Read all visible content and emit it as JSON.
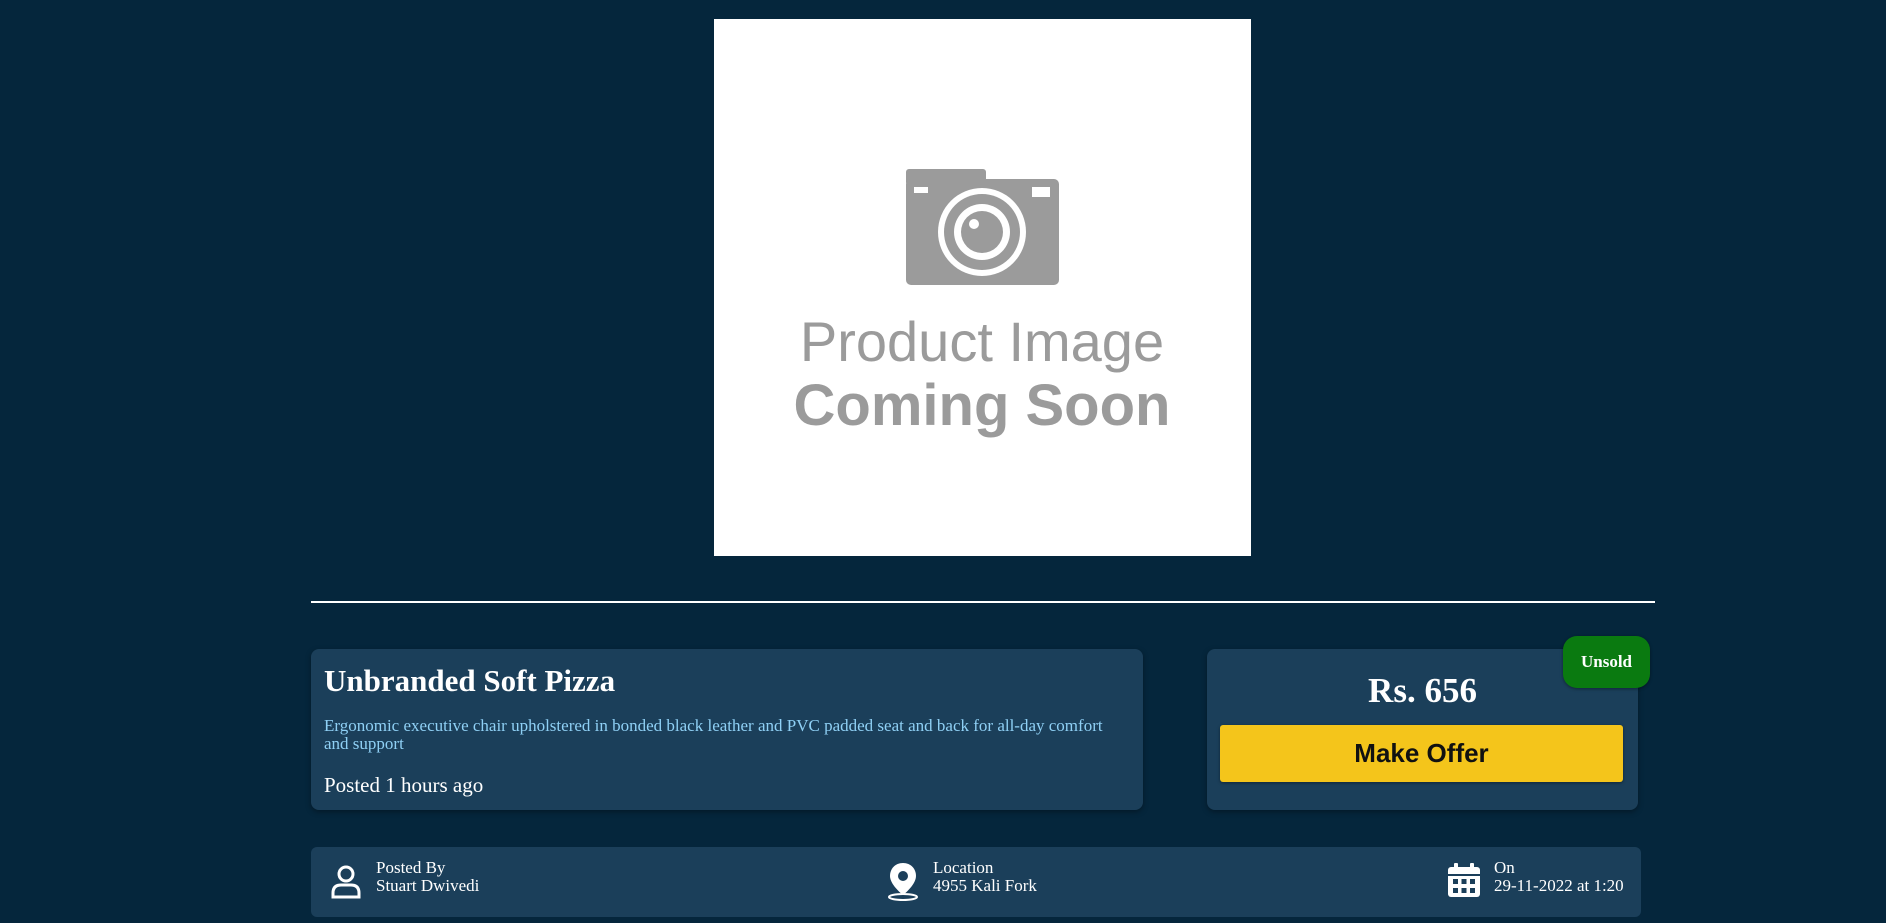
{
  "product": {
    "image_alt": "Product Image Coming Soon",
    "image_text_line1": "Product Image",
    "image_text_line2": "Coming Soon",
    "title": "Unbranded Soft Pizza",
    "description": "Ergonomic executive chair upholstered in bonded black leather and PVC padded seat and back for all-day comfort and support",
    "posted": "Posted 1 hours ago"
  },
  "pricing": {
    "price": "Rs. 656",
    "make_offer_label": "Make Offer",
    "status": "Unsold"
  },
  "meta": {
    "posted_by_label": "Posted By",
    "posted_by_value": "Stuart Dwivedi",
    "location_label": "Location",
    "location_value": "4955 Kali Fork",
    "date_label": "On",
    "date_value": "29-11-2022 at 1:20"
  },
  "colors": {
    "background": "#05263c",
    "card": "#1b3f5a",
    "accent_button": "#f4c51b",
    "status_unsold": "#0a7a10",
    "description_text": "#8fd0f5"
  },
  "icons": {
    "posted_by": "user-icon",
    "location": "location-pin-icon",
    "date": "calendar-icon",
    "placeholder": "camera-icon"
  }
}
